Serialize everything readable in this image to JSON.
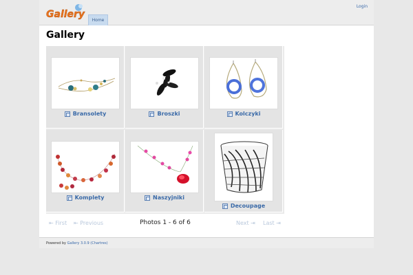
{
  "header": {
    "logo_text": "Gallery",
    "login_label": "Login",
    "nav_home_label": "Home"
  },
  "page_title": "Gallery",
  "albums": [
    {
      "label": "Bransolety"
    },
    {
      "label": "Broszki"
    },
    {
      "label": "Kolczyki"
    },
    {
      "label": "Komplety"
    },
    {
      "label": "Naszyjniki"
    },
    {
      "label": "Decoupage"
    }
  ],
  "pager": {
    "first_label": "⇤ First",
    "previous_label": "⇤ Previous",
    "status": "Photos 1 - 6 of 6",
    "next_label": "Next ⇥",
    "last_label": "Last ⇥"
  },
  "footer": {
    "powered_by": "Powered by",
    "gallery_version": "Gallery 3.0.9 (Chartres)"
  },
  "colors": {
    "link": "#3a6aa8",
    "background": "#e8e8e8"
  }
}
